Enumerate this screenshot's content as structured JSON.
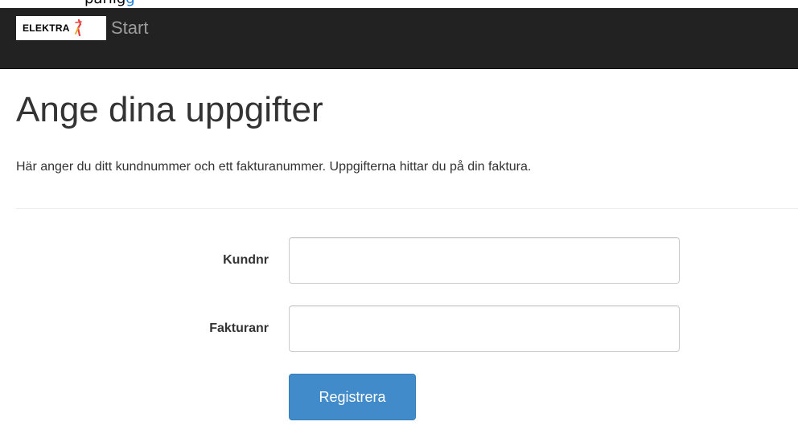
{
  "top_strip": {
    "text_prefix": "parlig",
    "text_link": "g"
  },
  "navbar": {
    "logo_text": "ELEKTRA",
    "start_link": "Start",
    "background_color": "#222222"
  },
  "main": {
    "title": "Ange dina uppgifter",
    "lead": "Här anger du ditt kundnummer och ett fakturanummer. Uppgifterna hittar du på din faktura."
  },
  "form": {
    "kundnr_label": "Kundnr",
    "kundnr_value": "",
    "fakturanr_label": "Fakturanr",
    "fakturanr_value": "",
    "submit_label": "Registrera",
    "submit_color": "#428bca"
  }
}
